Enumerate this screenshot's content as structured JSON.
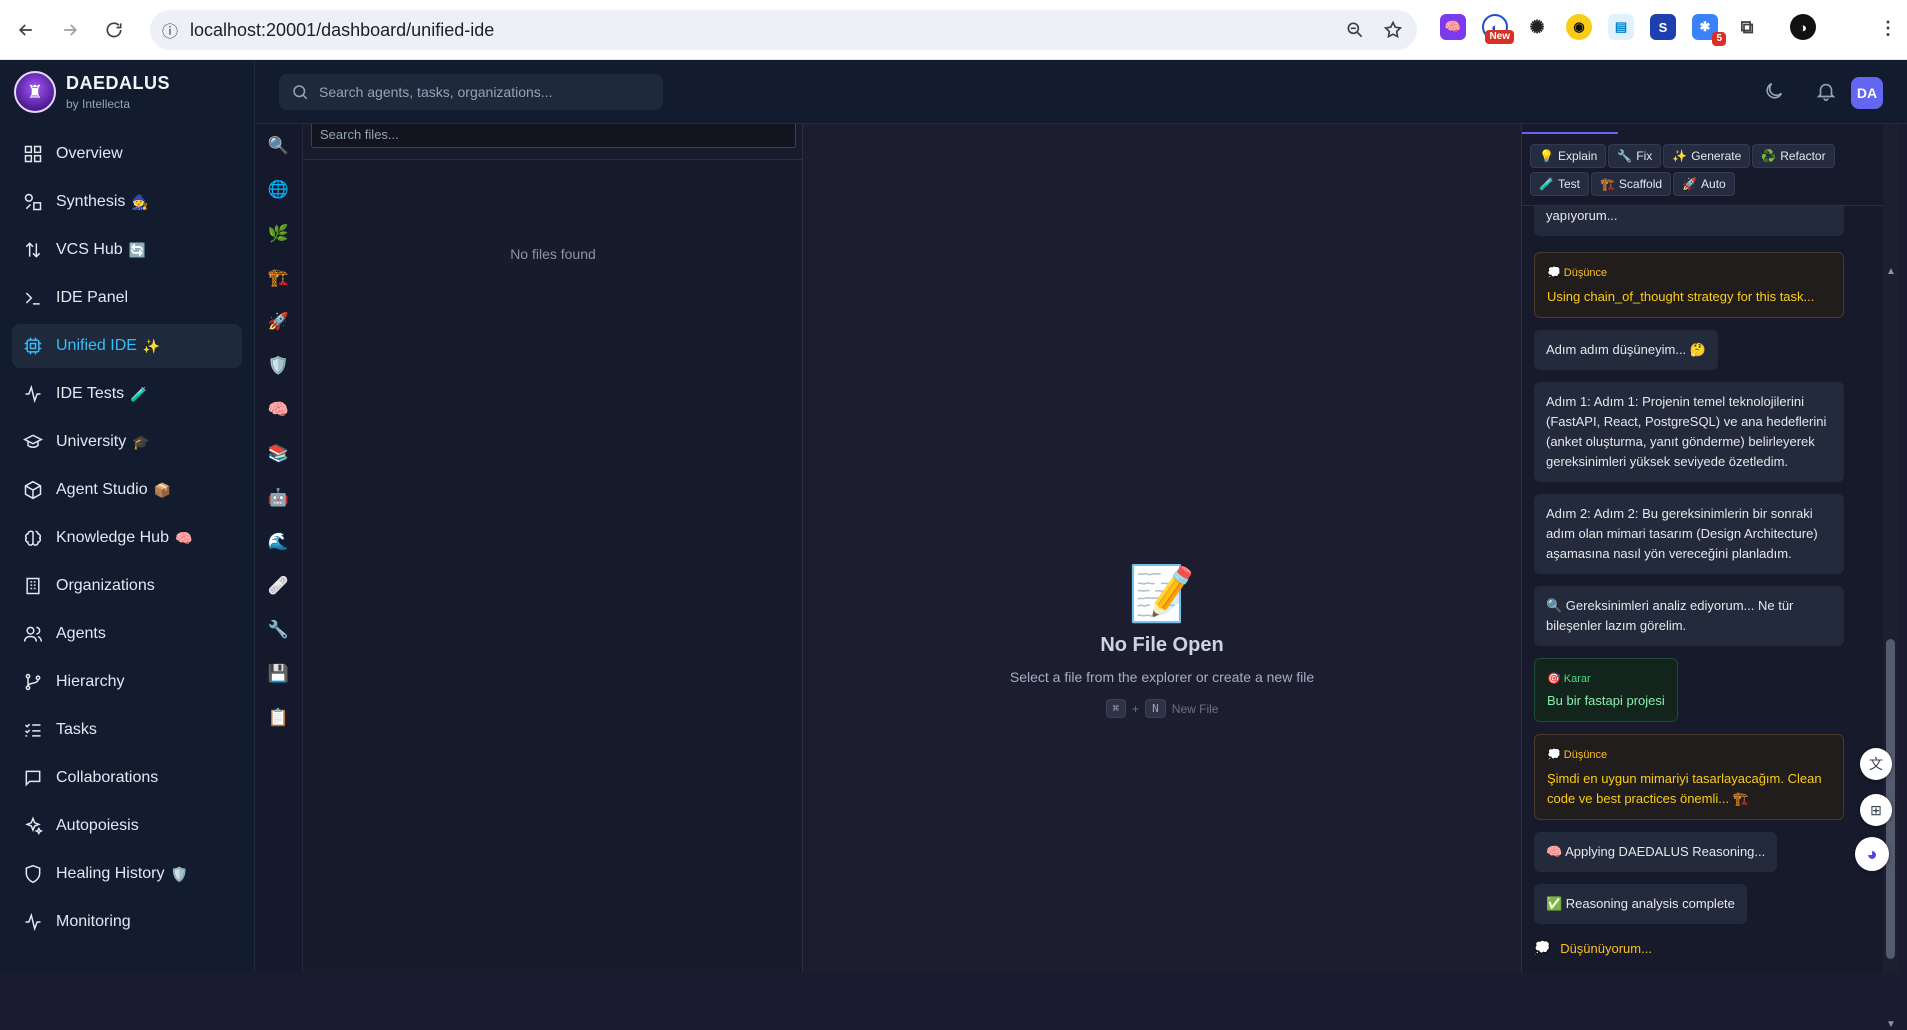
{
  "browser": {
    "url": "localhost:20001/dashboard/unified-ide",
    "extension_badge_new": "New",
    "extension_badge_count": "5"
  },
  "brand": {
    "title": "DAEDALUS",
    "subtitle": "by Intellecta"
  },
  "sidebar": {
    "items": [
      {
        "label": "Overview",
        "emoji": "",
        "icon": "grid-icon"
      },
      {
        "label": "Synthesis",
        "emoji": "🧙",
        "icon": "shapes-icon"
      },
      {
        "label": "VCS Hub",
        "emoji": "🔄",
        "icon": "arrows-updown-icon"
      },
      {
        "label": "IDE Panel",
        "emoji": "",
        "icon": "terminal-icon"
      },
      {
        "label": "Unified IDE",
        "emoji": "✨",
        "icon": "cpu-icon"
      },
      {
        "label": "IDE Tests",
        "emoji": "🧪",
        "icon": "activity-icon"
      },
      {
        "label": "University",
        "emoji": "🎓",
        "icon": "graduation-cap-icon"
      },
      {
        "label": "Agent Studio",
        "emoji": "📦",
        "icon": "package-icon"
      },
      {
        "label": "Knowledge Hub",
        "emoji": "🧠",
        "icon": "brain-icon"
      },
      {
        "label": "Organizations",
        "emoji": "",
        "icon": "building-icon"
      },
      {
        "label": "Agents",
        "emoji": "",
        "icon": "users-icon"
      },
      {
        "label": "Hierarchy",
        "emoji": "",
        "icon": "git-branch-icon"
      },
      {
        "label": "Tasks",
        "emoji": "",
        "icon": "list-checks-icon"
      },
      {
        "label": "Collaborations",
        "emoji": "",
        "icon": "message-square-icon"
      },
      {
        "label": "Autopoiesis",
        "emoji": "",
        "icon": "sparkles-icon"
      },
      {
        "label": "Healing History",
        "emoji": "🛡️",
        "icon": "shield-icon"
      },
      {
        "label": "Monitoring",
        "emoji": "",
        "icon": "activity-icon"
      }
    ],
    "active_index": 4
  },
  "topbar": {
    "search_placeholder": "Search agents, tasks, organizations...",
    "avatar_initials": "DA"
  },
  "activity_bar": [
    "🔍",
    "🌐",
    "🌿",
    "🏗️",
    "🚀",
    "🛡️",
    "🧠",
    "📚",
    "🤖",
    "🌊",
    "🩹",
    "🔧",
    "💾",
    "📋"
  ],
  "explorer": {
    "search_placeholder": "Search files...",
    "empty_text": "No files found"
  },
  "editor": {
    "empty_title": "No File Open",
    "empty_subtitle": "Select a file from the explorer or create a new file",
    "shortcut_key1": "⌘",
    "shortcut_plus": "+",
    "shortcut_key2": "N",
    "shortcut_label": "New File"
  },
  "assistant": {
    "quick_actions": [
      {
        "emoji": "💡",
        "label": "Explain"
      },
      {
        "emoji": "🔧",
        "label": "Fix"
      },
      {
        "emoji": "✨",
        "label": "Generate"
      },
      {
        "emoji": "♻️",
        "label": "Refactor"
      },
      {
        "emoji": "🧪",
        "label": "Test"
      },
      {
        "emoji": "🏗️",
        "label": "Scaffold"
      },
      {
        "emoji": "🚀",
        "label": "Auto"
      }
    ],
    "messages": {
      "m0": "yapıyorum...",
      "thought1_label": "💭 Düşünce",
      "thought1_text": "Using chain_of_thought strategy for this task...",
      "m2": "Adım adım düşüneyim... 🤔",
      "m3": "Adım 1: Adım 1: Projenin temel teknolojilerini (FastAPI, React, PostgreSQL) ve ana hedeflerini (anket oluşturma, yanıt gönderme) belirleyerek gereksinimleri yüksek seviyede özetledim.",
      "m4": "Adım 2: Adım 2: Bu gereksinimlerin bir sonraki adım olan mimari tasarım (Design Architecture) aşamasına nasıl yön vereceğini planladım.",
      "m5": "🔍 Gereksinimleri analiz ediyorum... Ne tür bileşenler lazım görelim.",
      "decision_label": "🎯 Karar",
      "decision_text": "Bu bir fastapi projesi",
      "thought2_label": "💭 Düşünce",
      "thought2_text": "Şimdi en uygun mimariyi tasarlayacağım. Clean code ve best practices önemli... 🏗️",
      "m8": "🧠 Applying DAEDALUS Reasoning...",
      "m9": "✅ Reasoning analysis complete",
      "thinking_icon": "💭",
      "thinking_text": "Düşünüyorum..."
    }
  }
}
